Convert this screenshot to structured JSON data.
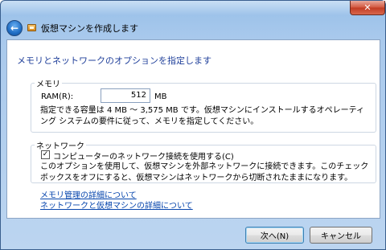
{
  "window": {
    "title": "仮想マシンを作成します",
    "close_symbol": "✕",
    "back_symbol": "←"
  },
  "main": {
    "heading": "メモリとネットワークのオプションを指定します",
    "memory": {
      "group_title": "メモリ",
      "ram_label": "RAM(R):",
      "ram_value": "512",
      "ram_unit": "MB",
      "description": "指定できる容量は 4 MB ～ 3,575 MB です。仮想マシンにインストールするオペレーティング システムの要件に従って、メモリを指定してください。"
    },
    "network": {
      "group_title": "ネットワーク",
      "checkbox_checked": true,
      "checkbox_label": "コンピューターのネットワーク接続を使用する(C)",
      "description": "このオプションを使用して、仮想マシンを外部ネットワークに接続できます。このチェック ボックスをオフにすると、仮想マシンはネットワークから切断されたままになります。"
    },
    "links": {
      "memory_details": "メモリ管理の詳細について",
      "network_details": "ネットワークと仮想マシンの詳細について"
    }
  },
  "buttons": {
    "next": "次へ(N)",
    "cancel": "キャンセル"
  },
  "icons": {
    "back": "back-arrow-icon",
    "app": "virtual-machine-icon",
    "close": "close-icon",
    "check": "checkmark-icon"
  }
}
